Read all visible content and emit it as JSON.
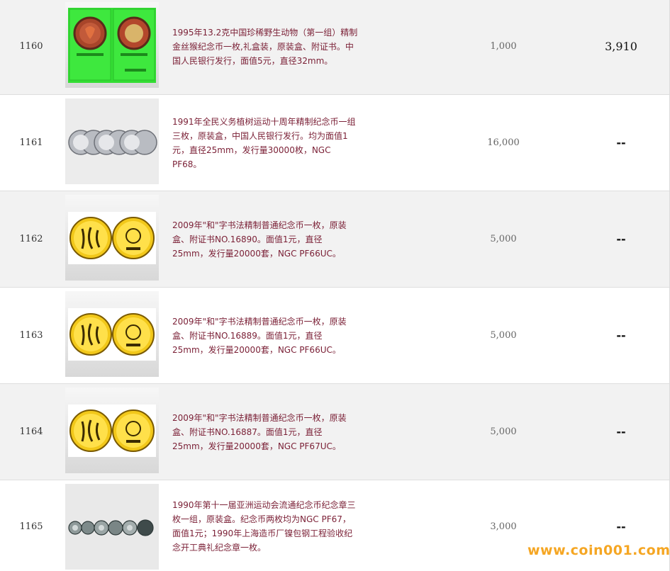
{
  "lots": [
    {
      "lot_no": "1160",
      "description": "1995年13.2克中国珍稀野生动物（第一组）精制金丝猴纪念币一枚,礼盒装，原装盒、附证书。中国人民银行发行，面值5元，直径32mm。",
      "estimate": "1,000",
      "result": "3,910",
      "image": "green-presentation-box-coins"
    },
    {
      "lot_no": "1161",
      "description": "1991年全民义务植树运动十周年精制纪念币一组三枚，原装盒，中国人民银行发行。均为面值1元，直径25mm，发行量30000枚，NGC PF68。",
      "estimate": "16,000",
      "result": "--",
      "image": "silver-coins-row"
    },
    {
      "lot_no": "1162",
      "description": "2009年\"和\"字书法精制普通纪念币一枚，原装盒、附证书NO.16890。面值1元，直径25mm，发行量20000套，NGC PF66UC。",
      "estimate": "5,000",
      "result": "--",
      "image": "gold-coin-pair"
    },
    {
      "lot_no": "1163",
      "description": "2009年\"和\"字书法精制普通纪念币一枚，原装盒、附证书NO.16889。面值1元，直径25mm，发行量20000套，NGC PF66UC。",
      "estimate": "5,000",
      "result": "--",
      "image": "gold-coin-pair"
    },
    {
      "lot_no": "1164",
      "description": "2009年\"和\"字书法精制普通纪念币一枚，原装盒、附证书NO.16887。面值1元，直径25mm，发行量20000套，NGC PF67UC。",
      "estimate": "5,000",
      "result": "--",
      "image": "gold-coin-pair"
    },
    {
      "lot_no": "1165",
      "description": "1990年第十一届亚洲运动会流通纪念币纪念章三枚一组，原装盒。纪念币两枚均为NGC PF67，面值1元；1990年上海造币厂镍包钢工程验收纪念开工典礼纪念章一枚。",
      "estimate": "3,000",
      "result": "--",
      "image": "small-coins-row"
    }
  ],
  "watermark": "www.coin001.com",
  "colors": {
    "description_text": "#7a1f35",
    "row_alt_bg": "#f2f2f2",
    "watermark": "#f5a623"
  }
}
